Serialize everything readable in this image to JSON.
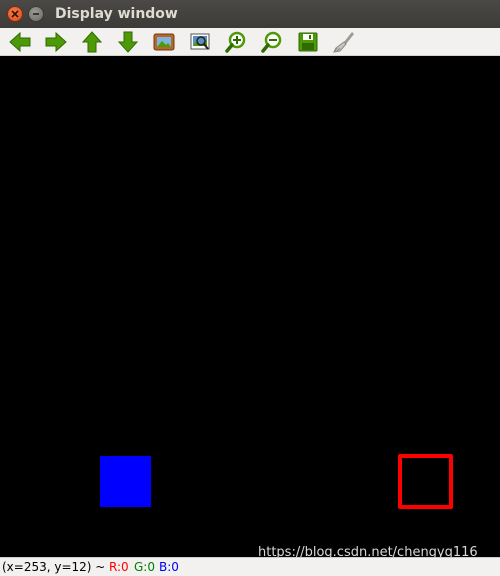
{
  "window": {
    "title": "Display window",
    "close_icon": "close-icon",
    "minimize_icon": "minimize-icon"
  },
  "toolbar": {
    "buttons": [
      {
        "name": "pan-left-button",
        "icon": "arrow-left-icon"
      },
      {
        "name": "pan-right-button",
        "icon": "arrow-right-icon"
      },
      {
        "name": "pan-up-button",
        "icon": "arrow-up-icon"
      },
      {
        "name": "pan-down-button",
        "icon": "arrow-down-icon"
      },
      {
        "name": "zoom-to-fit-button",
        "icon": "image-icon"
      },
      {
        "name": "zoom-original-button",
        "icon": "zoom-image-icon"
      },
      {
        "name": "zoom-in-button",
        "icon": "zoom-in-icon"
      },
      {
        "name": "zoom-out-button",
        "icon": "zoom-out-icon"
      },
      {
        "name": "save-button",
        "icon": "save-icon"
      },
      {
        "name": "properties-button",
        "icon": "brush-icon"
      }
    ]
  },
  "canvas": {
    "background": "#000000",
    "shapes": [
      {
        "name": "blue-filled-square",
        "color": "#0000ff",
        "style": "filled"
      },
      {
        "name": "red-outlined-square",
        "color": "#ff0000",
        "style": "outline"
      }
    ]
  },
  "status": {
    "coords": "(x=253, y=12) ~",
    "r": "R:0",
    "g": "G:0",
    "b": "B:0",
    "colors": {
      "r": "#ff0000",
      "g": "#008000",
      "b": "#0000ff"
    }
  },
  "watermark": "https://blog.csdn.net/chengyq116"
}
